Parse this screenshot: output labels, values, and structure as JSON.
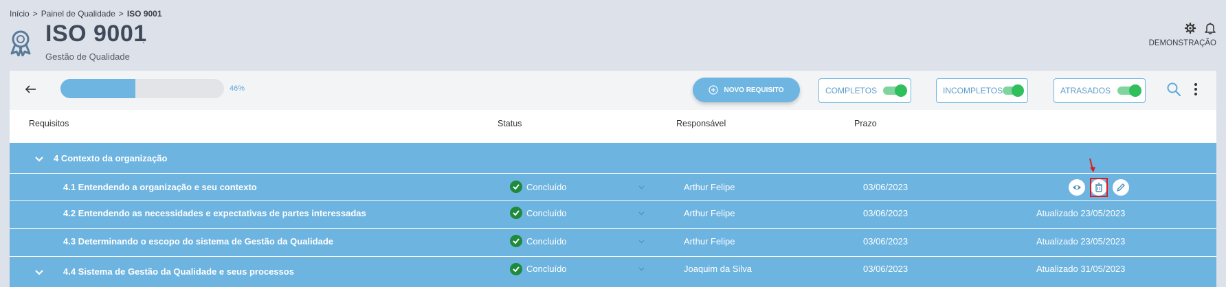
{
  "breadcrumb": {
    "home": "Início",
    "parent": "Painel de Qualidade",
    "current": "ISO 9001",
    "separator": ">"
  },
  "header": {
    "title": "ISO 9001",
    "dot": ".",
    "subtitle": "Gestão de Qualidade",
    "user": "DEMONSTRAÇÃO"
  },
  "toolbar": {
    "progress": 0.46,
    "progress_label": "46%",
    "new_button": "NOVO REQUISITO",
    "filters": [
      {
        "label": "COMPLETOS",
        "on": true
      },
      {
        "label": "INCOMPLETOS",
        "on": true
      },
      {
        "label": "ATRASADOS",
        "on": true
      }
    ]
  },
  "columns": {
    "req": "Requisitos",
    "status": "Status",
    "owner": "Responsável",
    "due": "Prazo"
  },
  "group": {
    "label": "4 Contexto da organização"
  },
  "rows": [
    {
      "label": "4.1 Entendendo a organização e seu contexto",
      "status": "Concluído",
      "owner": "Arthur Felipe",
      "due": "03/06/2023",
      "extra": ""
    },
    {
      "label": "4.2 Entendendo as necessidades e expectativas de partes interessadas",
      "status": "Concluído",
      "owner": "Arthur Felipe",
      "due": "03/06/2023",
      "extra": "Atualizado 23/05/2023"
    },
    {
      "label": "4.3 Determinando o escopo do sistema de Gestão da Qualidade",
      "status": "Concluído",
      "owner": "Arthur Felipe",
      "due": "03/06/2023",
      "extra": "Atualizado 23/05/2023"
    },
    {
      "label": "4.4 Sistema de Gestão da Qualidade e seus processos",
      "status": "Concluído",
      "owner": "Joaquim da Silva",
      "due": "03/06/2023",
      "extra": "Atualizado 31/05/2023"
    }
  ],
  "colors": {
    "accent": "#6db4e0",
    "success": "#1e8a3c",
    "highlight": "#e01b1b"
  }
}
